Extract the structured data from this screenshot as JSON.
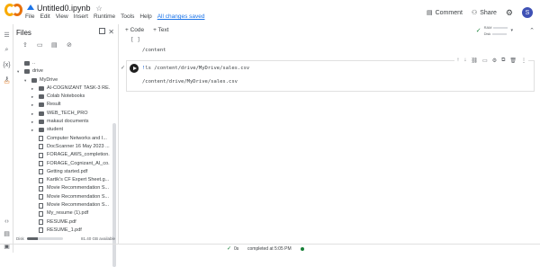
{
  "app": {
    "notebook_title": "Untitled0.ipynb",
    "menu": [
      "File",
      "Edit",
      "View",
      "Insert",
      "Runtime",
      "Tools",
      "Help"
    ],
    "save_status": "All changes saved",
    "comment_label": "Comment",
    "share_label": "Share",
    "avatar_letter": "S"
  },
  "files_panel": {
    "title": "Files",
    "tree": [
      {
        "label": "..",
        "depth": 0,
        "type": "folder",
        "caret": ""
      },
      {
        "label": "drive",
        "depth": 0,
        "type": "folder",
        "caret": "▾"
      },
      {
        "label": "MyDrive",
        "depth": 1,
        "type": "folder",
        "caret": "▾"
      },
      {
        "label": "AI-COGNIZANT TASK-3 RE...",
        "depth": 2,
        "type": "folder",
        "caret": "▸"
      },
      {
        "label": "Colab Notebooks",
        "depth": 2,
        "type": "folder",
        "caret": "▸"
      },
      {
        "label": "Result",
        "depth": 2,
        "type": "folder",
        "caret": "▸"
      },
      {
        "label": "WEB_TECH_PRO",
        "depth": 2,
        "type": "folder",
        "caret": "▸"
      },
      {
        "label": "makaut documents",
        "depth": 2,
        "type": "folder",
        "caret": "▸"
      },
      {
        "label": "student",
        "depth": 2,
        "type": "folder",
        "caret": "▸"
      },
      {
        "label": "Computer Networks and I...",
        "depth": 2,
        "type": "file",
        "caret": ""
      },
      {
        "label": "DocScanner 16 May 2023 ...",
        "depth": 2,
        "type": "file",
        "caret": ""
      },
      {
        "label": "FORAGE_AWS_completion...",
        "depth": 2,
        "type": "file",
        "caret": ""
      },
      {
        "label": "FORAGE_Cognizant_AI_co...",
        "depth": 2,
        "type": "file",
        "caret": ""
      },
      {
        "label": "Getting started.pdf",
        "depth": 2,
        "type": "file",
        "caret": ""
      },
      {
        "label": "Kartik's CF Expert Sheet.g...",
        "depth": 2,
        "type": "file",
        "caret": ""
      },
      {
        "label": "Movie Recommendation S...",
        "depth": 2,
        "type": "file",
        "caret": ""
      },
      {
        "label": "Movie Recommendation S...",
        "depth": 2,
        "type": "file",
        "caret": ""
      },
      {
        "label": "Movie Recommendation S...",
        "depth": 2,
        "type": "file",
        "caret": ""
      },
      {
        "label": "My_resume (1).pdf",
        "depth": 2,
        "type": "file",
        "caret": ""
      },
      {
        "label": "RESUME.pdf",
        "depth": 2,
        "type": "file",
        "caret": ""
      },
      {
        "label": "RESUME_1.pdf",
        "depth": 2,
        "type": "file",
        "caret": ""
      }
    ],
    "disk_label": "Disk",
    "disk_usage": "81.40 GB available",
    "disk_fraction_used": 0.3
  },
  "toolbar": {
    "code_label": "+ Code",
    "text_label": "+ Text",
    "ram_label": "RAM",
    "disk_label": "Disk"
  },
  "cells": {
    "prev_bracket": "[ ]",
    "prev_output": "/content",
    "code": "!ls /content/drive/MyDrive/sales.csv",
    "output": "/content/drive/MyDrive/sales.csv"
  },
  "status": {
    "time": "0s",
    "text": "completed at 5:05 PM"
  },
  "icons": {
    "logo": "colab-logo",
    "drive": "drive-icon",
    "run": "play-icon"
  }
}
